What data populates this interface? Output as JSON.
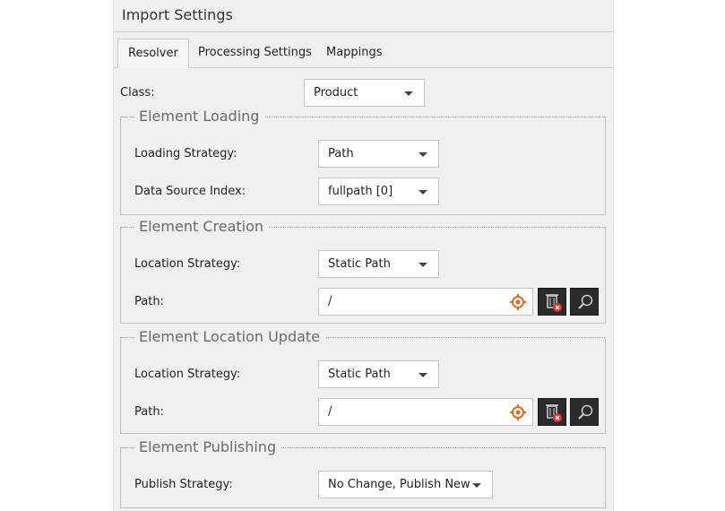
{
  "window": {
    "title": "Import Settings"
  },
  "tabs": [
    {
      "label": "Resolver",
      "active": true
    },
    {
      "label": "Processing Settings",
      "active": false
    },
    {
      "label": "Mappings",
      "active": false
    }
  ],
  "class_field": {
    "label": "Class:",
    "value": "Product"
  },
  "element_loading": {
    "legend": "Element Loading",
    "loading_strategy": {
      "label": "Loading Strategy:",
      "value": "Path"
    },
    "data_source_index": {
      "label": "Data Source Index:",
      "value": "fullpath [0]"
    }
  },
  "element_creation": {
    "legend": "Element Creation",
    "location_strategy": {
      "label": "Location Strategy:",
      "value": "Static Path"
    },
    "path": {
      "label": "Path:",
      "value": "/"
    }
  },
  "element_location_update": {
    "legend": "Element Location Update",
    "location_strategy": {
      "label": "Location Strategy:",
      "value": "Static Path"
    },
    "path": {
      "label": "Path:",
      "value": "/"
    }
  },
  "element_publishing": {
    "legend": "Element Publishing",
    "publish_strategy": {
      "label": "Publish Strategy:",
      "value": "No Change, Publish New"
    }
  },
  "colors": {
    "panel_bg": "#f0f0f0",
    "target_icon": "#e06a1b",
    "dark_button": "#2b2b2b",
    "delete_badge": "#d9342b"
  },
  "icons": [
    "target-icon",
    "delete-icon",
    "search-icon",
    "chevron-down-icon"
  ]
}
